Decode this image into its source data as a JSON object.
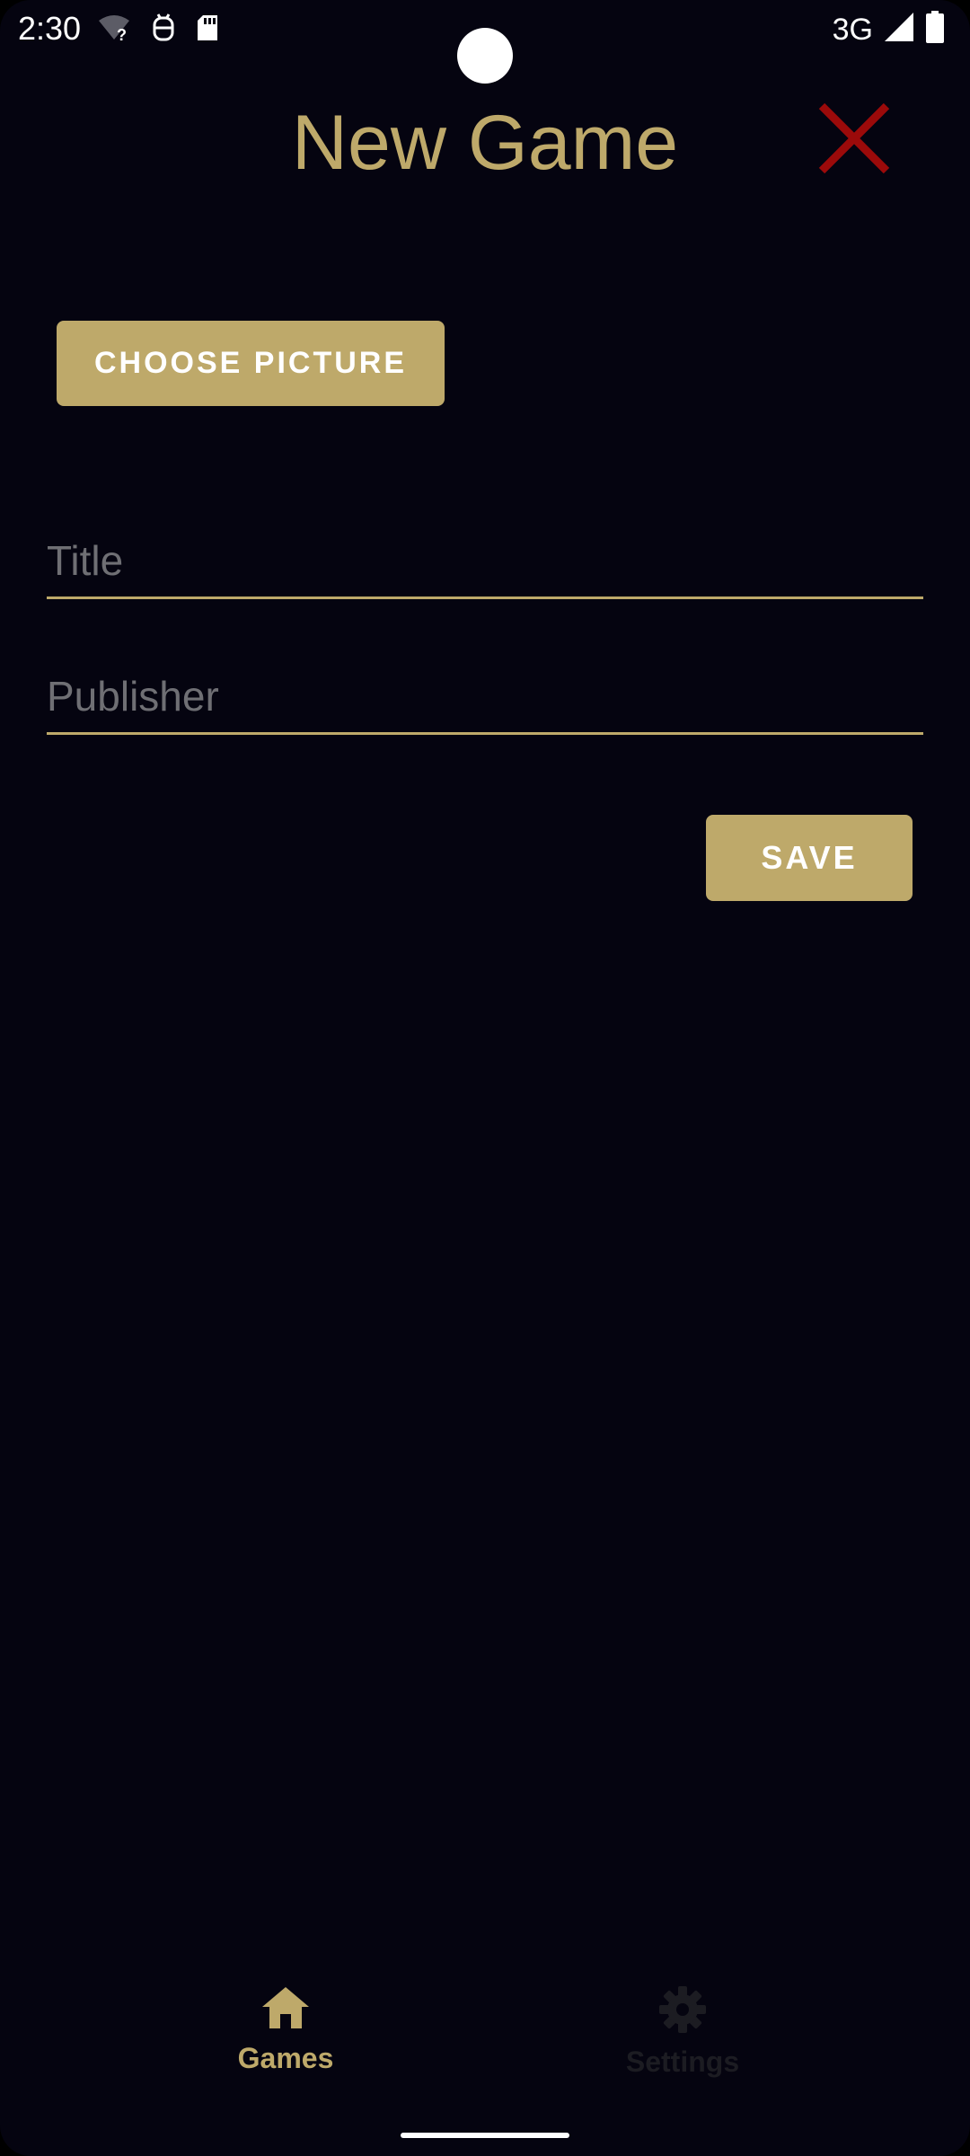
{
  "status_bar": {
    "time": "2:30",
    "network": "3G",
    "icons": [
      "wifi-unknown-icon",
      "android-debug-icon",
      "sd-card-icon",
      "signal-icon",
      "battery-icon"
    ]
  },
  "header": {
    "title": "New Game",
    "close_icon": "close-icon"
  },
  "form": {
    "choose_picture_label": "CHOOSE PICTURE",
    "title_placeholder": "Title",
    "title_value": "",
    "publisher_placeholder": "Publisher",
    "publisher_value": "",
    "save_label": "SAVE"
  },
  "bottom_nav": {
    "items": [
      {
        "label": "Games",
        "icon": "home-icon",
        "active": true
      },
      {
        "label": "Settings",
        "icon": "gear-icon",
        "active": false
      }
    ]
  },
  "colors": {
    "background": "#050410",
    "accent": "#bea96a",
    "close": "#9b0a0a",
    "placeholder": "#6f6f74"
  }
}
